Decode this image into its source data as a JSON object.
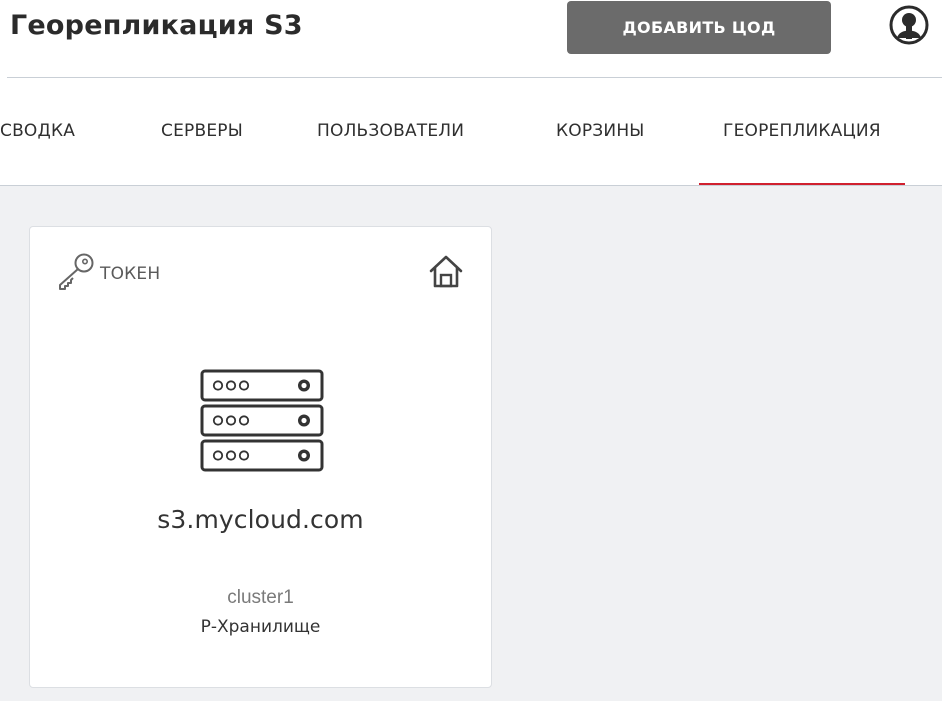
{
  "header": {
    "title": "Георепликация S3",
    "add_button_label": "ДОБАВИТЬ ЦОД",
    "user_icon": "user-circle-icon"
  },
  "tabs": [
    {
      "label": "СВОДКА",
      "active": false
    },
    {
      "label": "СЕРВЕРЫ",
      "active": false
    },
    {
      "label": "ПОЛЬЗОВАТЕЛИ",
      "active": false
    },
    {
      "label": "КОРЗИНЫ",
      "active": false
    },
    {
      "label": "ГЕОРЕПЛИКАЦИЯ",
      "active": true
    }
  ],
  "card": {
    "token_label": "ТОКЕН",
    "token_icon": "key-icon",
    "home_icon": "home-icon",
    "server_icon": "server-stack-icon",
    "hostname": "s3.mycloud.com",
    "cluster": "cluster1",
    "storage_type": "Р-Хранилище"
  },
  "colors": {
    "accent_red": "#d0202e",
    "button_gray": "#6b6b6b",
    "content_bg": "#f0f1f3",
    "divider": "#c9cfd6"
  }
}
